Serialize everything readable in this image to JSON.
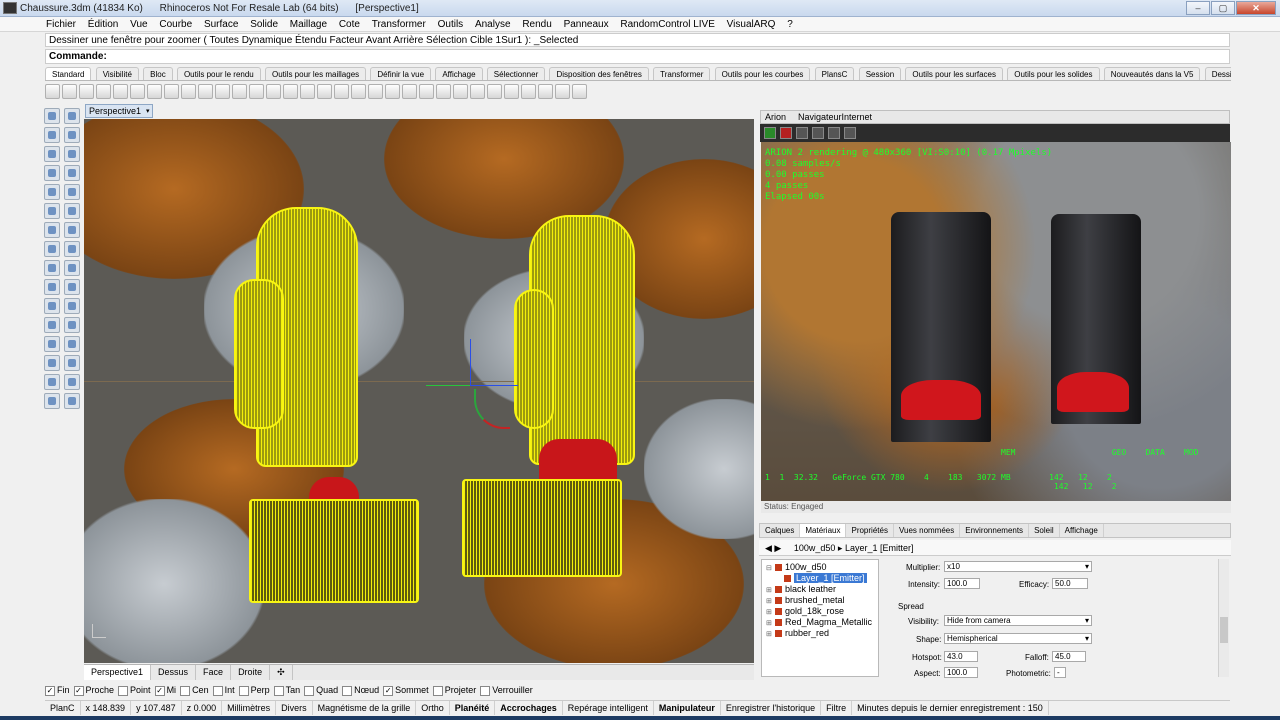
{
  "window": {
    "tabs": [
      "Chaussure.3dm (41834 Ko)",
      "Rhinoceros Not For Resale Lab (64 bits)",
      "[Perspective1]"
    ],
    "buttons": [
      "–",
      "▢",
      "✕"
    ]
  },
  "menu": [
    "Fichier",
    "Édition",
    "Vue",
    "Courbe",
    "Surface",
    "Solide",
    "Maillage",
    "Cote",
    "Transformer",
    "Outils",
    "Analyse",
    "Rendu",
    "Panneaux",
    "RandomControl LIVE",
    "VisualARQ",
    "?"
  ],
  "command": {
    "history": "Dessiner une fenêtre pour zoomer ( Toutes  Dynamique  Étendu  Facteur  Avant  Arrière  Sélection  Cible  1Sur1 ): _Selected",
    "label": "Commande:",
    "value": ""
  },
  "toolbar_tabs": [
    "Standard",
    "Visibilité",
    "Bloc",
    "Outils pour le rendu",
    "Outils pour les maillages",
    "Définir la vue",
    "Affichage",
    "Sélectionner",
    "Disposition des fenêtres",
    "Transformer",
    "Outils pour les courbes",
    "PlansC",
    "Session",
    "Outils pour les surfaces",
    "Outils pour les solides",
    "Nouveautés dans la V5",
    "Dessin"
  ],
  "viewport": {
    "title": "Perspective1",
    "tabs": [
      "Perspective1",
      "Dessus",
      "Face",
      "Droite",
      "✣"
    ]
  },
  "arion": {
    "tabs": [
      "Arion",
      "NavigateurInternet"
    ],
    "overlay": "ARION 2 rendering @ 480x360 [VI:S0:10] (0.17 Mpixels)\n0.08 samples/s\n0.00 passes\n4 passes\nElapsed 00s",
    "stats": "1  1  32.32   GeForce GTX 780    4    183   3072 MB        142   12    2\n                                                            142   12    2",
    "stats_headers": "MEM                    GEO    DATA    MOD",
    "status": "Status: Engaged"
  },
  "panel_tabs": [
    "Calques",
    "Matériaux",
    "Propriétés",
    "Vues nommées",
    "Environnements",
    "Soleil",
    "Affichage"
  ],
  "breadcrumb": [
    "100w_d50",
    "Layer_1 [Emitter]"
  ],
  "materials": [
    {
      "label": "100w_d50",
      "expander": "⊟"
    },
    {
      "label": "Layer_1 [Emitter]",
      "expander": ""
    },
    {
      "label": "black leather",
      "expander": "⊞"
    },
    {
      "label": "brushed_metal",
      "expander": "⊞"
    },
    {
      "label": "gold_18k_rose",
      "expander": "⊞"
    },
    {
      "label": "Red_Magma_Metallic",
      "expander": "⊞"
    },
    {
      "label": "rubber_red",
      "expander": "⊞"
    }
  ],
  "props": {
    "multiplier_label": "Multiplier:",
    "multiplier": "x10",
    "intensity_label": "Intensity:",
    "intensity": "100.0",
    "efficacy_label": "Efficacy:",
    "efficacy": "50.0",
    "spread_label": "Spread",
    "visibility_label": "Visibility:",
    "visibility": "Hide from camera",
    "shape_label": "Shape:",
    "shape": "Hemispherical",
    "hotspot_label": "Hotspot:",
    "hotspot": "43.0",
    "falloff_label": "Falloff:",
    "falloff": "45.0",
    "aspect_label": "Aspect:",
    "aspect": "100.0",
    "photometric_label": "Photometric:",
    "photometric": "-"
  },
  "osnaps": [
    {
      "label": "Fin",
      "on": true
    },
    {
      "label": "Proche",
      "on": true
    },
    {
      "label": "Point",
      "on": false
    },
    {
      "label": "Mi",
      "on": true
    },
    {
      "label": "Cen",
      "on": false
    },
    {
      "label": "Int",
      "on": false
    },
    {
      "label": "Perp",
      "on": false
    },
    {
      "label": "Tan",
      "on": false
    },
    {
      "label": "Quad",
      "on": false
    },
    {
      "label": "Nœud",
      "on": false
    },
    {
      "label": "Sommet",
      "on": true
    },
    {
      "label": "Projeter",
      "on": false
    },
    {
      "label": "Verrouiller",
      "on": false
    }
  ],
  "status": {
    "plane": "PlanC",
    "x": "x 148.839",
    "y": "y 107.487",
    "z": "z 0.000",
    "units": "Millimètres",
    "layer": "Divers",
    "items": [
      "Magnétisme de la grille",
      "Ortho",
      "Planéité",
      "Accrochages",
      "Repérage intelligent",
      "Manipulateur",
      "Enregistrer l'historique",
      "Filtre",
      "Minutes depuis le dernier enregistrement : 150"
    ]
  }
}
